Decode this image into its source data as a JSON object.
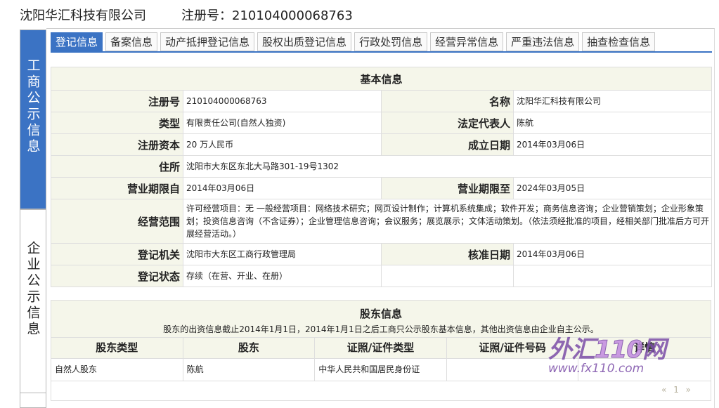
{
  "header": {
    "company": "沈阳华汇科技有限公司",
    "reg_label": "注册号：210104000068763"
  },
  "side": {
    "active": "工商公示信息",
    "inactive": "企业公示信息"
  },
  "tabs": [
    "登记信息",
    "备案信息",
    "动产抵押登记信息",
    "股权出质登记信息",
    "行政处罚信息",
    "经营异常信息",
    "严重违法信息",
    "抽查检查信息"
  ],
  "basic": {
    "title": "基本信息",
    "reg_no_label": "注册号",
    "reg_no": "210104000068763",
    "name_label": "名称",
    "name": "沈阳华汇科技有限公司",
    "type_label": "类型",
    "type": "有限责任公司(自然人独资)",
    "legal_label": "法定代表人",
    "legal": "陈航",
    "capital_label": "注册资本",
    "capital": "20 万人民币",
    "founded_label": "成立日期",
    "founded": "2014年03月06日",
    "address_label": "住所",
    "address": "沈阳市大东区东北大马路301-19号1302",
    "term_from_label": "营业期限自",
    "term_from": "2014年03月06日",
    "term_to_label": "营业期限至",
    "term_to": "2024年03月05日",
    "scope_label": "经营范围",
    "scope": "许可经营项目：无 一般经营项目：网络技术研究；网页设计制作；计算机系统集成；软件开发；商务信息咨询；企业营销策划；企业形象策划；投资信息咨询（不含证券）；企业管理信息咨询；会议服务；展览展示；文体活动策划。（依法须经批准的项目，经相关部门批准后方可开展经营活动。）",
    "authority_label": "登记机关",
    "authority": "沈阳市大东区工商行政管理局",
    "approve_label": "核准日期",
    "approve": "2014年03月06日",
    "status_label": "登记状态",
    "status": "存续（在营、开业、在册）"
  },
  "shareholders": {
    "title": "股东信息",
    "note": "股东的出资信息截止2014年1月1日，2014年1月1日之后工商只公示股东基本信息，其他出资信息由企业自主公示。",
    "columns": [
      "股东类型",
      "股东",
      "证照/证件类型",
      "证照/证件号码",
      "详情"
    ],
    "rows": [
      [
        "自然人股东",
        "陈航",
        "中华人民共和国居民身份证",
        "",
        ""
      ]
    ],
    "pager": {
      "prev": "«",
      "page": "1",
      "next": "»"
    }
  },
  "watermark": {
    "top_a": "外汇",
    "top_b": "110",
    "top_c": "网",
    "bottom": "www.fx110.com"
  }
}
